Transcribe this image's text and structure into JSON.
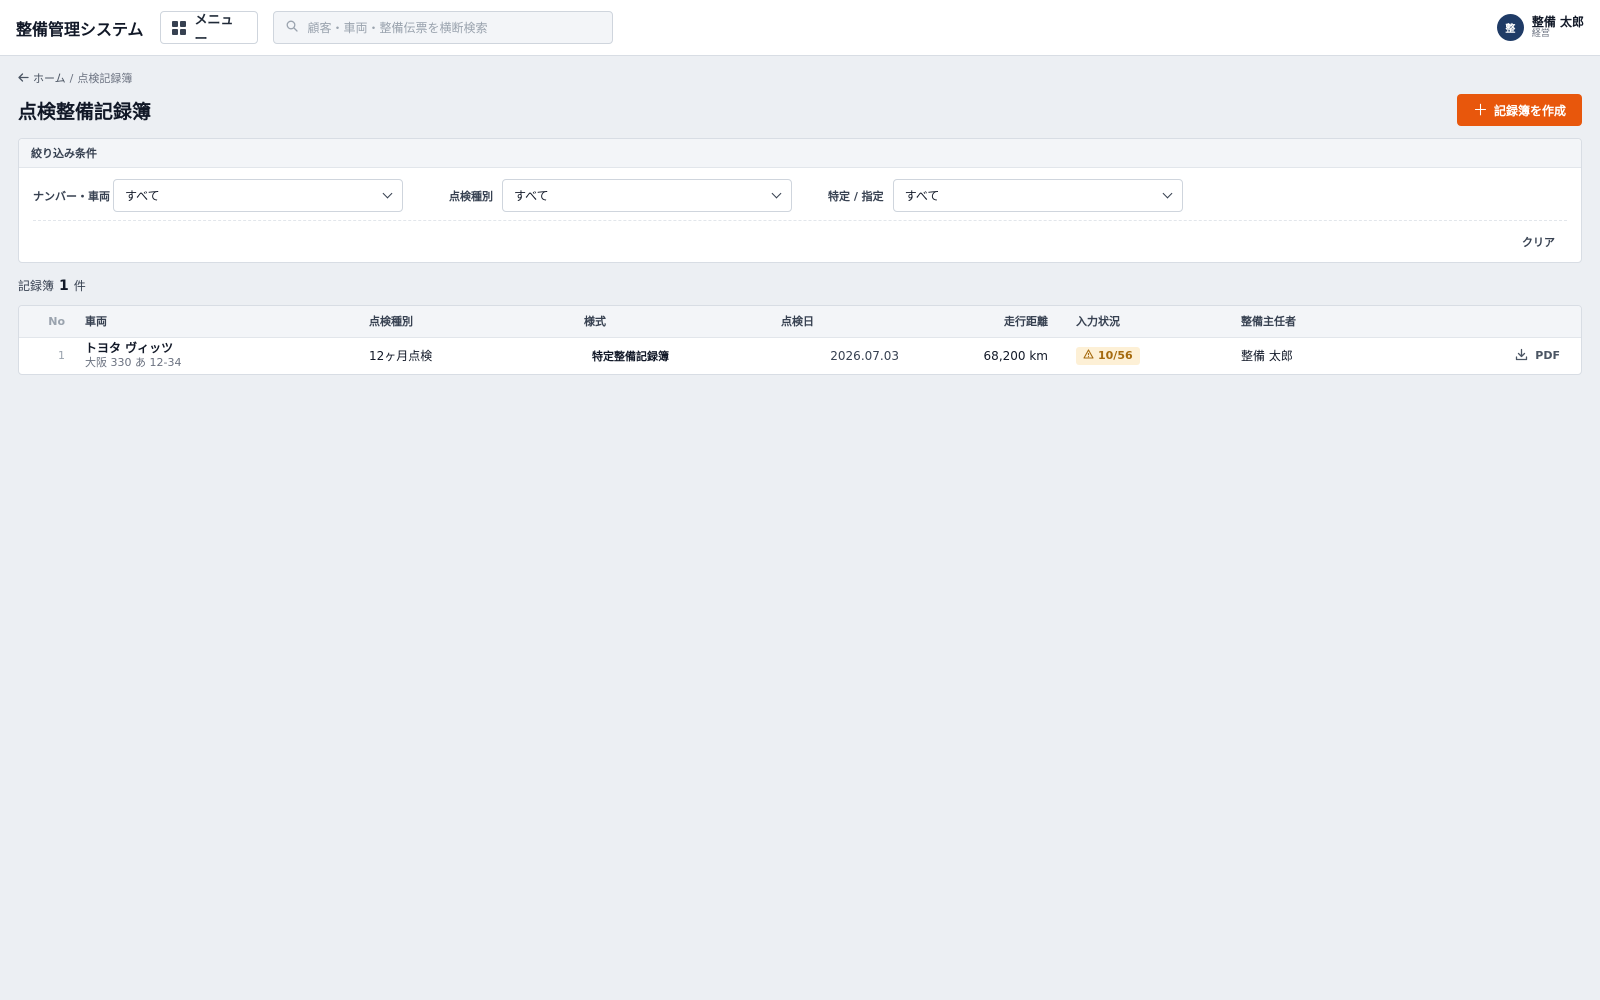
{
  "header": {
    "app_title": "整備管理システム",
    "menu_label": "メニュー",
    "search_placeholder": "顧客・車両・整備伝票を横断検索",
    "user": {
      "initial": "整",
      "name": "整備 太郎",
      "role": "経営"
    }
  },
  "breadcrumb": {
    "home": "ホーム",
    "separator": "/",
    "current": "点検記録簿"
  },
  "page": {
    "title": "点検整備記録簿",
    "create_button": "記録簿を作成"
  },
  "filters": {
    "heading": "絞り込み条件",
    "fields": [
      {
        "label": "ナンバー・車両",
        "value": "すべて"
      },
      {
        "label": "点検種別",
        "value": "すべて"
      },
      {
        "label": "特定 / 指定",
        "value": "すべて"
      }
    ],
    "clear_label": "クリア"
  },
  "summary": {
    "prefix": "記録簿",
    "count": "1",
    "suffix": "件"
  },
  "table": {
    "columns": {
      "no": "No",
      "vehicle": "車両",
      "inspection_type": "点検種別",
      "form": "様式",
      "date": "点検日",
      "mileage": "走行距離",
      "input_status": "入力状況",
      "chief": "整備主任者"
    },
    "rows": [
      {
        "no": "1",
        "vehicle_name": "トヨタ ヴィッツ",
        "plate": "大阪 330 あ 12-34",
        "inspection_type": "12ヶ月点検",
        "form": "特定整備記録簿",
        "date": "2026.07.03",
        "mileage": "68,200 km",
        "input_status": "10/56",
        "chief": "整備 太郎",
        "action_label": "PDF"
      }
    ]
  },
  "colors": {
    "accent": "#e8570c",
    "avatar": "#1f3b66",
    "warning_bg": "#fdf0d6",
    "warning_text": "#a56a0e"
  }
}
